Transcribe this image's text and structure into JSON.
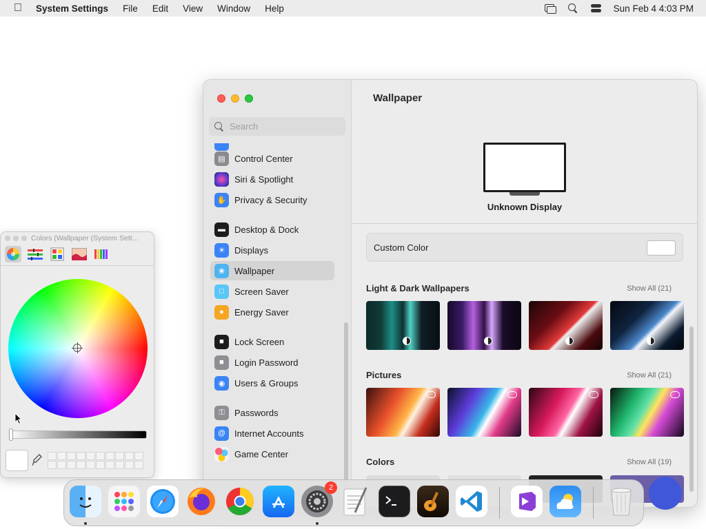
{
  "menubar": {
    "app": "System Settings",
    "menus": [
      "File",
      "Edit",
      "View",
      "Window",
      "Help"
    ],
    "datetime": "Sun Feb 4  4:03 PM"
  },
  "sidebar": {
    "search_placeholder": "Search",
    "items": [
      {
        "label": "Control Center",
        "icon": "control-center-icon",
        "color": "#7b7b80"
      },
      {
        "label": "Siri & Spotlight",
        "icon": "siri-icon",
        "color": "#5a3bd6"
      },
      {
        "label": "Privacy & Security",
        "icon": "hand-icon",
        "color": "#3a84f5"
      },
      {
        "label": "Desktop & Dock",
        "icon": "dock-icon",
        "color": "#1d1d1f"
      },
      {
        "label": "Displays",
        "icon": "displays-icon",
        "color": "#3a84f5"
      },
      {
        "label": "Wallpaper",
        "icon": "wallpaper-icon",
        "color": "#4fb3f0"
      },
      {
        "label": "Screen Saver",
        "icon": "screen-saver-icon",
        "color": "#59c7f5"
      },
      {
        "label": "Energy Saver",
        "icon": "bulb-icon",
        "color": "#f5a623"
      },
      {
        "label": "Lock Screen",
        "icon": "lock-icon",
        "color": "#1d1d1f"
      },
      {
        "label": "Login Password",
        "icon": "login-lock-icon",
        "color": "#8e8e93"
      },
      {
        "label": "Users & Groups",
        "icon": "users-icon",
        "color": "#3a84f5"
      },
      {
        "label": "Passwords",
        "icon": "key-icon",
        "color": "#8e8e93"
      },
      {
        "label": "Internet Accounts",
        "icon": "at-icon",
        "color": "#3a84f5"
      },
      {
        "label": "Game Center",
        "icon": "game-center-icon",
        "color": "#ffffff"
      }
    ],
    "active": "Wallpaper"
  },
  "content": {
    "title": "Wallpaper",
    "display_name": "Unknown Display",
    "custom_color_label": "Custom Color",
    "sections": [
      {
        "title": "Light & Dark Wallpapers",
        "show_all": "Show All (21)"
      },
      {
        "title": "Pictures",
        "show_all": "Show All (21)"
      },
      {
        "title": "Colors",
        "show_all": "Show All (19)"
      }
    ]
  },
  "colors_panel": {
    "title": "Colors (Wallpaper (System Sett...",
    "tools": [
      "color-wheel-icon",
      "sliders-icon",
      "palettes-icon",
      "image-palette-icon",
      "pencils-icon"
    ]
  },
  "dock": {
    "apps": [
      {
        "name": "Finder",
        "icon": "finder-icon",
        "running": true
      },
      {
        "name": "Launchpad",
        "icon": "launchpad-icon",
        "running": false
      },
      {
        "name": "Safari",
        "icon": "safari-icon",
        "running": false
      },
      {
        "name": "Firefox",
        "icon": "firefox-icon",
        "running": false
      },
      {
        "name": "Chrome",
        "icon": "chrome-icon",
        "running": false
      },
      {
        "name": "App Store",
        "icon": "app-store-icon",
        "running": false
      },
      {
        "name": "System Settings",
        "icon": "system-settings-icon",
        "running": true,
        "badge": "2"
      },
      {
        "name": "TextEdit",
        "icon": "textedit-icon",
        "running": false
      },
      {
        "name": "Terminal",
        "icon": "terminal-icon",
        "running": false
      },
      {
        "name": "GarageBand",
        "icon": "garageband-icon",
        "running": false
      },
      {
        "name": "VS Code",
        "icon": "vscode-icon",
        "running": false
      },
      {
        "name": "Visual Studio",
        "icon": "visual-studio-icon",
        "running": false
      },
      {
        "name": "Weather",
        "icon": "weather-icon",
        "running": false
      },
      {
        "name": "Trash",
        "icon": "trash-icon",
        "running": false
      }
    ]
  }
}
